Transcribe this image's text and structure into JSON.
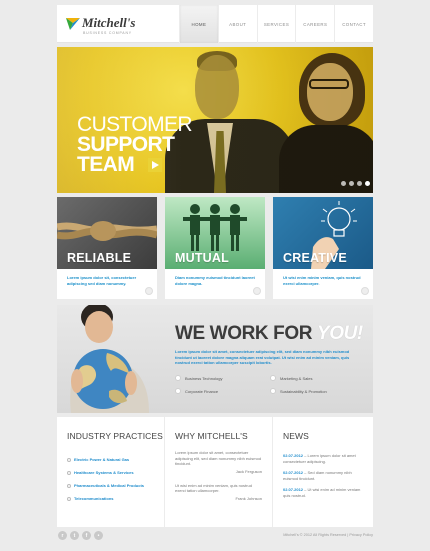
{
  "brand": {
    "name": "Mitchell's",
    "tagline": "BUSINESS COMPANY",
    "mark_colors": [
      "#f0b20a",
      "#36a93c",
      "#1f8ccc"
    ]
  },
  "nav": {
    "items": [
      {
        "label": "HOME",
        "active": true
      },
      {
        "label": "ABOUT",
        "active": false
      },
      {
        "label": "SERVICES",
        "active": false
      },
      {
        "label": "CAREERS",
        "active": false
      },
      {
        "label": "CONTACT",
        "active": false
      }
    ]
  },
  "hero": {
    "line1": "CUSTOMER",
    "line2": "SUPPORT",
    "line3": "TEAM",
    "arrow_icon": "chevron-right-icon",
    "slide_count": 4,
    "active_slide": 4
  },
  "features": [
    {
      "title": "RELIABLE",
      "text": "Lorem ipsum dolor sit, consectetuer adipiscing sed diam nonummy."
    },
    {
      "title": "MUTUAL",
      "text": "Diam nonummy euismod tincidunt laoreet dolore magna."
    },
    {
      "title": "CREATIVE",
      "text": "Ut wisi enim minim veniam, quis nostrud exerci ullamcorper."
    }
  ],
  "wework": {
    "headline": "WE WORK FOR",
    "highlight": "YOU!",
    "text": "Lorem ipsum dolor sit amet, consectetuer adipiscing elit, sed diam nonummy nibh euismod tincidunt ut laoreet dolore magna aliquam erat volutpat. Ut wisi enim ad minim veniam, quis nostrud exerci tation ullamcorper suscipit lobortis.",
    "items": [
      "Business Technology",
      "Marketing & Sales",
      "Corporate Finance",
      "Sustainability & Promotion"
    ]
  },
  "industry": {
    "title": "INDUSTRY PRACTICES",
    "items": [
      "Electric Power & Natural Gas",
      "Healthcare Systems & Services",
      "Pharmaceuticals & Medical Products",
      "Telecommunications"
    ]
  },
  "why": {
    "title": "WHY MITCHELL'S",
    "quote1": "Lorem ipsum dolor sit amet, consectetuer adipiscing elit, sed diam nonummy nibh euismod tincidunt.",
    "author1": "Jack Ferguson",
    "quote2": "Ut wisi enim ad minim veniam, quis nostrud exerci tation ullamcorper.",
    "author2": "Frank Johnson"
  },
  "news": {
    "title": "NEWS",
    "items": [
      {
        "date": "02.07.2012",
        "text": "Lorem ipsum dolor sit amet consectetuer adipiscing."
      },
      {
        "date": "02.07.2012",
        "text": "Sed diam nonummy nibh euismod tincidunt."
      },
      {
        "date": "02.07.2012",
        "text": "Ut wisi enim ad minim veniam quis nostrud."
      }
    ]
  },
  "footer": {
    "social": [
      {
        "icon": "rss-icon",
        "glyph": "r"
      },
      {
        "icon": "twitter-icon",
        "glyph": "t"
      },
      {
        "icon": "facebook-icon",
        "glyph": "f"
      },
      {
        "icon": "flickr-icon",
        "glyph": "•"
      }
    ],
    "copyright": "Mitchell's © 2012 All Rights Reserved  |  Privacy Policy"
  }
}
